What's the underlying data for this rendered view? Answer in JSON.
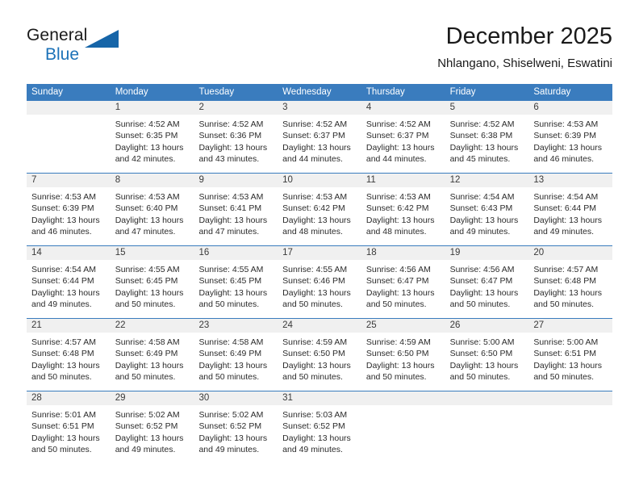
{
  "brand": {
    "name_part1": "General",
    "name_part2": "Blue",
    "logo_icon": "triangle-logo-icon"
  },
  "header": {
    "title": "December 2025",
    "subtitle": "Nhlangano, Shiselweni, Eswatini"
  },
  "colors": {
    "header_blue": "#3a7cbe",
    "brand_blue": "#1c72b8",
    "day_band_gray": "#f0f0f0",
    "text": "#2b2b2b"
  },
  "weekdays": [
    "Sunday",
    "Monday",
    "Tuesday",
    "Wednesday",
    "Thursday",
    "Friday",
    "Saturday"
  ],
  "weeks": [
    [
      {
        "day": "",
        "empty": true,
        "sunrise": "",
        "sunset": "",
        "daylight": ""
      },
      {
        "day": "1",
        "sunrise": "Sunrise: 4:52 AM",
        "sunset": "Sunset: 6:35 PM",
        "daylight": "Daylight: 13 hours and 42 minutes."
      },
      {
        "day": "2",
        "sunrise": "Sunrise: 4:52 AM",
        "sunset": "Sunset: 6:36 PM",
        "daylight": "Daylight: 13 hours and 43 minutes."
      },
      {
        "day": "3",
        "sunrise": "Sunrise: 4:52 AM",
        "sunset": "Sunset: 6:37 PM",
        "daylight": "Daylight: 13 hours and 44 minutes."
      },
      {
        "day": "4",
        "sunrise": "Sunrise: 4:52 AM",
        "sunset": "Sunset: 6:37 PM",
        "daylight": "Daylight: 13 hours and 44 minutes."
      },
      {
        "day": "5",
        "sunrise": "Sunrise: 4:52 AM",
        "sunset": "Sunset: 6:38 PM",
        "daylight": "Daylight: 13 hours and 45 minutes."
      },
      {
        "day": "6",
        "sunrise": "Sunrise: 4:53 AM",
        "sunset": "Sunset: 6:39 PM",
        "daylight": "Daylight: 13 hours and 46 minutes."
      }
    ],
    [
      {
        "day": "7",
        "sunrise": "Sunrise: 4:53 AM",
        "sunset": "Sunset: 6:39 PM",
        "daylight": "Daylight: 13 hours and 46 minutes."
      },
      {
        "day": "8",
        "sunrise": "Sunrise: 4:53 AM",
        "sunset": "Sunset: 6:40 PM",
        "daylight": "Daylight: 13 hours and 47 minutes."
      },
      {
        "day": "9",
        "sunrise": "Sunrise: 4:53 AM",
        "sunset": "Sunset: 6:41 PM",
        "daylight": "Daylight: 13 hours and 47 minutes."
      },
      {
        "day": "10",
        "sunrise": "Sunrise: 4:53 AM",
        "sunset": "Sunset: 6:42 PM",
        "daylight": "Daylight: 13 hours and 48 minutes."
      },
      {
        "day": "11",
        "sunrise": "Sunrise: 4:53 AM",
        "sunset": "Sunset: 6:42 PM",
        "daylight": "Daylight: 13 hours and 48 minutes."
      },
      {
        "day": "12",
        "sunrise": "Sunrise: 4:54 AM",
        "sunset": "Sunset: 6:43 PM",
        "daylight": "Daylight: 13 hours and 49 minutes."
      },
      {
        "day": "13",
        "sunrise": "Sunrise: 4:54 AM",
        "sunset": "Sunset: 6:44 PM",
        "daylight": "Daylight: 13 hours and 49 minutes."
      }
    ],
    [
      {
        "day": "14",
        "sunrise": "Sunrise: 4:54 AM",
        "sunset": "Sunset: 6:44 PM",
        "daylight": "Daylight: 13 hours and 49 minutes."
      },
      {
        "day": "15",
        "sunrise": "Sunrise: 4:55 AM",
        "sunset": "Sunset: 6:45 PM",
        "daylight": "Daylight: 13 hours and 50 minutes."
      },
      {
        "day": "16",
        "sunrise": "Sunrise: 4:55 AM",
        "sunset": "Sunset: 6:45 PM",
        "daylight": "Daylight: 13 hours and 50 minutes."
      },
      {
        "day": "17",
        "sunrise": "Sunrise: 4:55 AM",
        "sunset": "Sunset: 6:46 PM",
        "daylight": "Daylight: 13 hours and 50 minutes."
      },
      {
        "day": "18",
        "sunrise": "Sunrise: 4:56 AM",
        "sunset": "Sunset: 6:47 PM",
        "daylight": "Daylight: 13 hours and 50 minutes."
      },
      {
        "day": "19",
        "sunrise": "Sunrise: 4:56 AM",
        "sunset": "Sunset: 6:47 PM",
        "daylight": "Daylight: 13 hours and 50 minutes."
      },
      {
        "day": "20",
        "sunrise": "Sunrise: 4:57 AM",
        "sunset": "Sunset: 6:48 PM",
        "daylight": "Daylight: 13 hours and 50 minutes."
      }
    ],
    [
      {
        "day": "21",
        "sunrise": "Sunrise: 4:57 AM",
        "sunset": "Sunset: 6:48 PM",
        "daylight": "Daylight: 13 hours and 50 minutes."
      },
      {
        "day": "22",
        "sunrise": "Sunrise: 4:58 AM",
        "sunset": "Sunset: 6:49 PM",
        "daylight": "Daylight: 13 hours and 50 minutes."
      },
      {
        "day": "23",
        "sunrise": "Sunrise: 4:58 AM",
        "sunset": "Sunset: 6:49 PM",
        "daylight": "Daylight: 13 hours and 50 minutes."
      },
      {
        "day": "24",
        "sunrise": "Sunrise: 4:59 AM",
        "sunset": "Sunset: 6:50 PM",
        "daylight": "Daylight: 13 hours and 50 minutes."
      },
      {
        "day": "25",
        "sunrise": "Sunrise: 4:59 AM",
        "sunset": "Sunset: 6:50 PM",
        "daylight": "Daylight: 13 hours and 50 minutes."
      },
      {
        "day": "26",
        "sunrise": "Sunrise: 5:00 AM",
        "sunset": "Sunset: 6:50 PM",
        "daylight": "Daylight: 13 hours and 50 minutes."
      },
      {
        "day": "27",
        "sunrise": "Sunrise: 5:00 AM",
        "sunset": "Sunset: 6:51 PM",
        "daylight": "Daylight: 13 hours and 50 minutes."
      }
    ],
    [
      {
        "day": "28",
        "sunrise": "Sunrise: 5:01 AM",
        "sunset": "Sunset: 6:51 PM",
        "daylight": "Daylight: 13 hours and 50 minutes."
      },
      {
        "day": "29",
        "sunrise": "Sunrise: 5:02 AM",
        "sunset": "Sunset: 6:52 PM",
        "daylight": "Daylight: 13 hours and 49 minutes."
      },
      {
        "day": "30",
        "sunrise": "Sunrise: 5:02 AM",
        "sunset": "Sunset: 6:52 PM",
        "daylight": "Daylight: 13 hours and 49 minutes."
      },
      {
        "day": "31",
        "sunrise": "Sunrise: 5:03 AM",
        "sunset": "Sunset: 6:52 PM",
        "daylight": "Daylight: 13 hours and 49 minutes."
      },
      {
        "day": "",
        "empty": true,
        "sunrise": "",
        "sunset": "",
        "daylight": ""
      },
      {
        "day": "",
        "empty": true,
        "sunrise": "",
        "sunset": "",
        "daylight": ""
      },
      {
        "day": "",
        "empty": true,
        "sunrise": "",
        "sunset": "",
        "daylight": ""
      }
    ]
  ]
}
